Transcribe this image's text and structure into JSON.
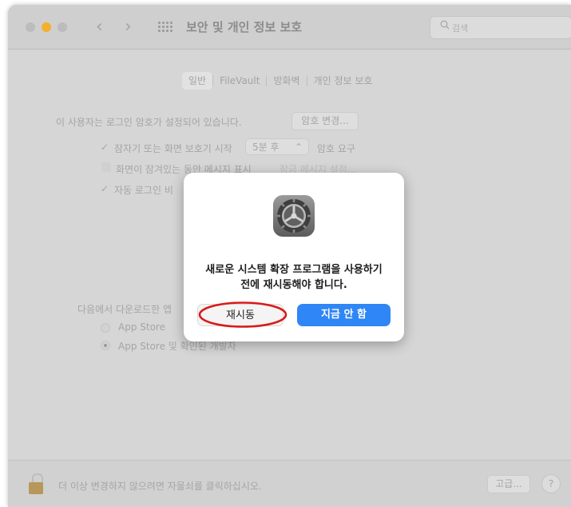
{
  "window": {
    "title": "보안 및 개인 정보 보호",
    "search_placeholder": "검색",
    "nav_back_glyph": "‹",
    "nav_forward_glyph": "›"
  },
  "tabs": [
    {
      "label": "일반",
      "active": true
    },
    {
      "label": "FileVault",
      "active": false
    },
    {
      "label": "방화벽",
      "active": false
    },
    {
      "label": "개인 정보 보호",
      "active": false
    }
  ],
  "general": {
    "password_notice": "이 사용자는 로그인 암호가 설정되어 있습니다.",
    "change_password_button": "암호 변경...",
    "require_password": {
      "checked": true,
      "check_glyph": "✓",
      "label_prefix": "잠자기 또는 화면 보호기 시작",
      "delay_value": "5분 후",
      "stepper_glyph": "⌃",
      "label_suffix": "암호 요구"
    },
    "show_message": {
      "checked": false,
      "label": "화면이 잠겨있는 동안 메시지 표시",
      "button": "잠금 메시지 설정..."
    },
    "disable_auto_login": {
      "checked": true,
      "check_glyph": "✓",
      "label": "자동 로그인 비"
    },
    "allow_apps_heading": "다음에서 다운로드한 앱",
    "app_sources": [
      {
        "label": "App Store",
        "selected": false
      },
      {
        "label": "App Store 및 확인된 개발자",
        "selected": true
      }
    ]
  },
  "footer": {
    "lock_text": "더 이상 변경하지 않으려면 자물쇠를 클릭하십시오.",
    "advanced_button": "고급...",
    "help_button": "?"
  },
  "dialog": {
    "icon": "system-preferences-gear-icon",
    "message_line1": "새로운 시스템 확장 프로그램을 사용하기",
    "message_line2": "전에 재시동해야 합니다.",
    "restart_button": "재시동",
    "not_now_button": "지금 안 함"
  },
  "colors": {
    "accent": "#2f86f5",
    "annotation": "#d91a1a",
    "traffic_yellow": "#f3b02a"
  }
}
